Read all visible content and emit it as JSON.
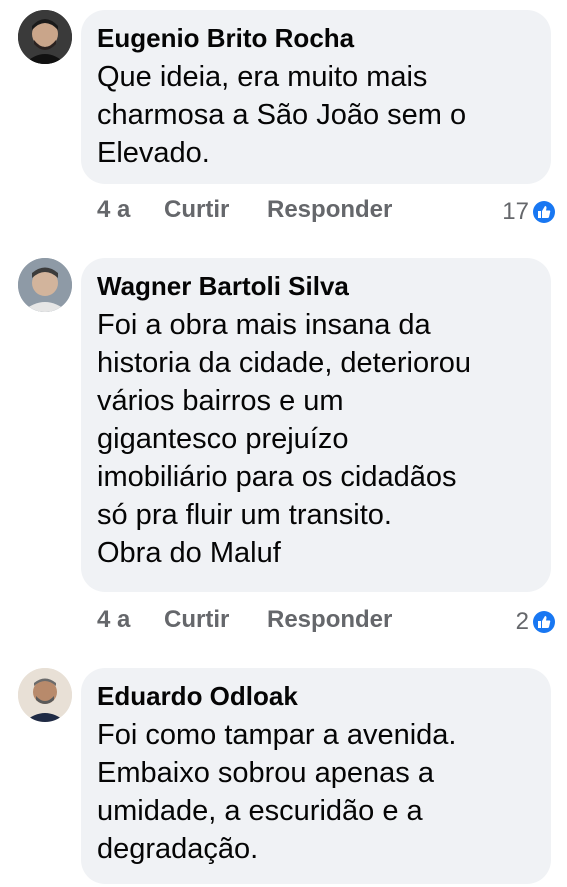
{
  "comments": [
    {
      "author": "Eugenio Brito Rocha",
      "text": "Que ideia, era muito mais\ncharmosa a São João sem o\nElevado.",
      "time": "4 a",
      "like_label": "Curtir",
      "reply_label": "Responder",
      "reaction_count": "17",
      "avatar_colors": {
        "bg": "#2b2b2b",
        "face": "#c9a58a"
      }
    },
    {
      "author": "Wagner Bartoli Silva",
      "text": "Foi a obra mais insana da\nhistoria da cidade, deteriorou\nvários bairros e um\ngigantesco prejuízo\nimobiliário para os cidadãos\nsó  pra fluir um transito.\nObra do Maluf",
      "time": "4 a",
      "like_label": "Curtir",
      "reply_label": "Responder",
      "reaction_count": "2",
      "avatar_colors": {
        "bg": "#9aa5b1",
        "face": "#d2b49c"
      }
    },
    {
      "author": "Eduardo Odloak",
      "text": "Foi como tampar a avenida.\nEmbaixo sobrou apenas a\numidade, a escuridão e a\ndegradação.",
      "avatar_colors": {
        "bg": "#e8e0d6",
        "face": "#b88a6b"
      }
    }
  ],
  "theme": {
    "bubble": "#f0f2f5",
    "meta_text": "#65676b",
    "like_blue": "#1877f2"
  }
}
